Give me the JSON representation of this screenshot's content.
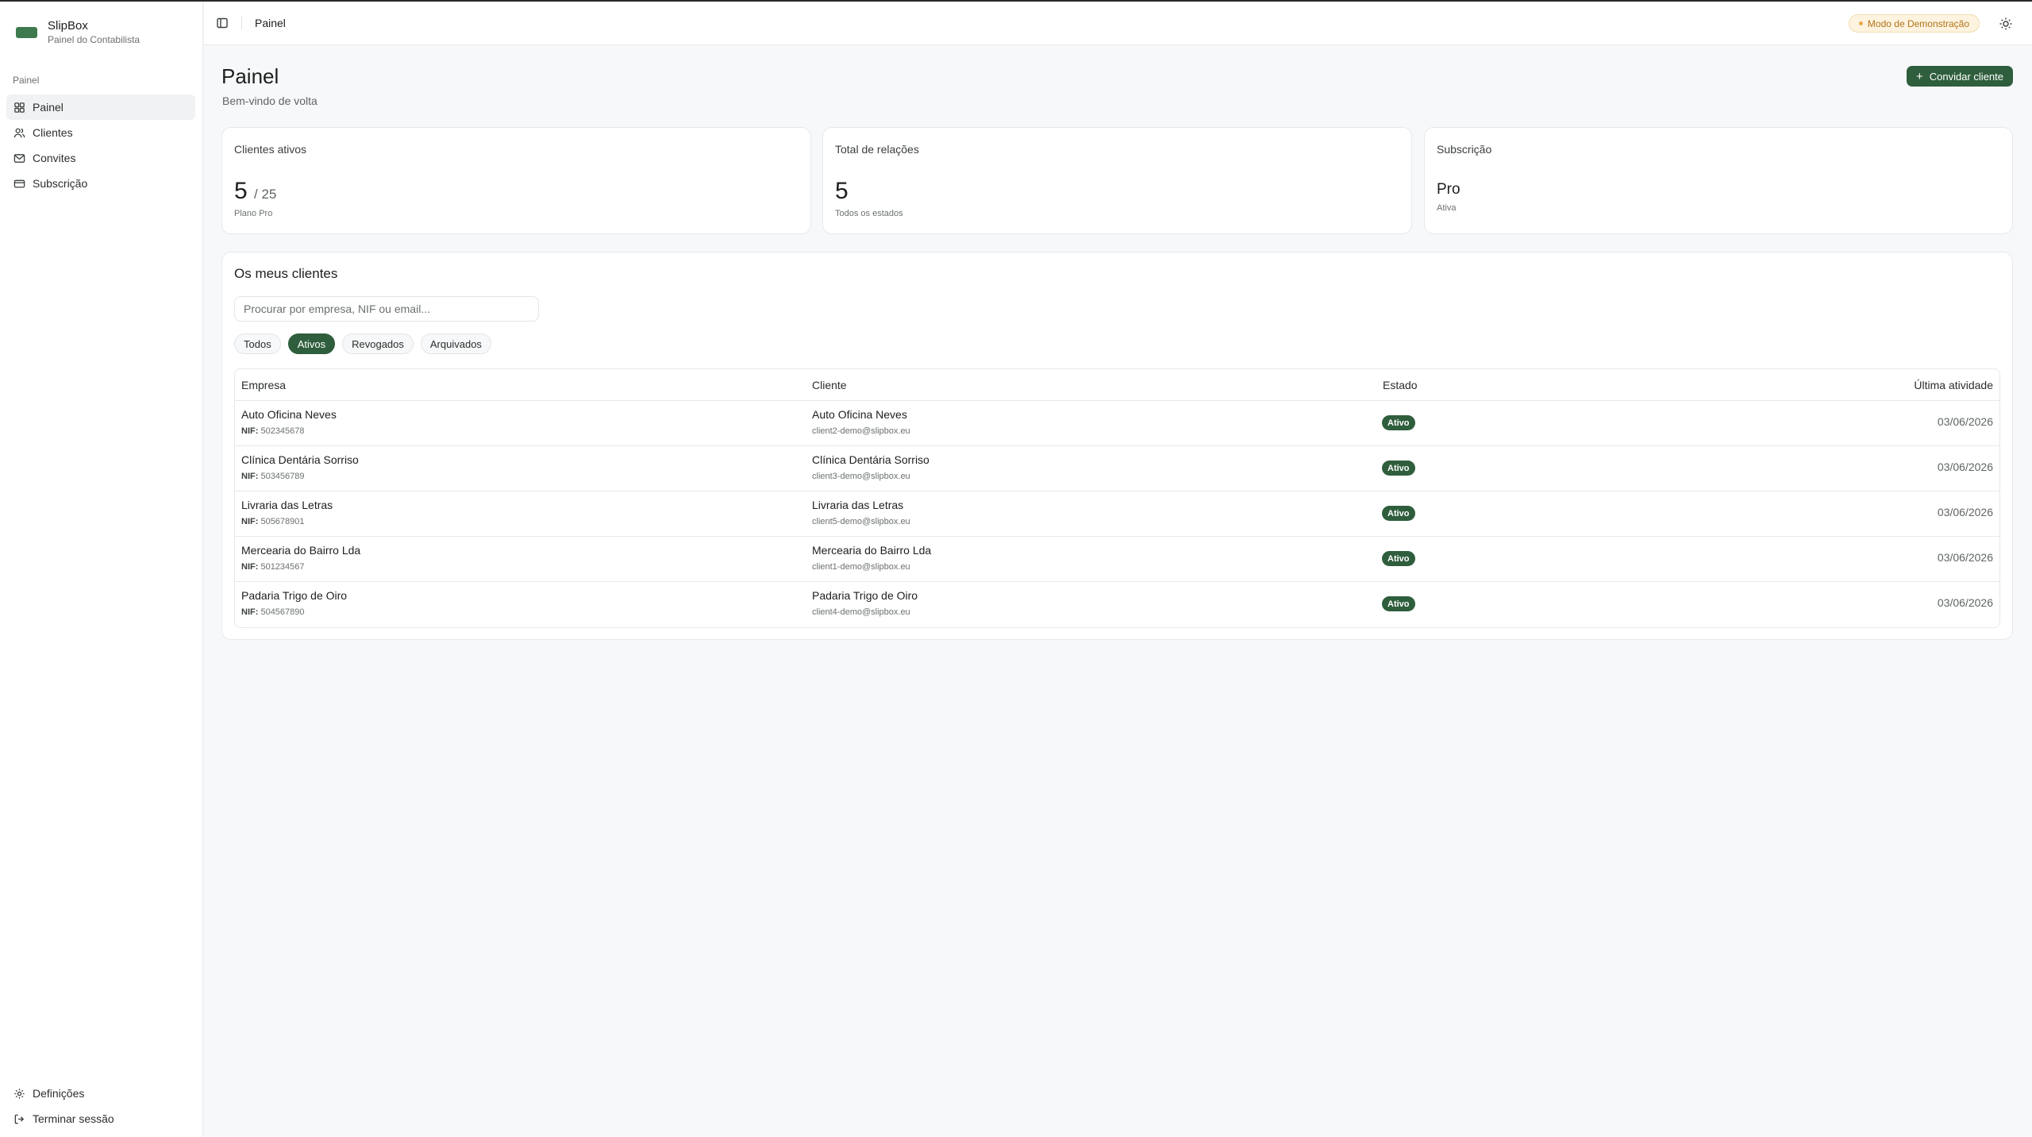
{
  "brand": {
    "name": "SlipBox",
    "subtitle": "Painel do Contabilista"
  },
  "sidebar": {
    "group_label": "Painel",
    "items": [
      {
        "label": "Painel",
        "icon": "grid-icon",
        "active": true
      },
      {
        "label": "Clientes",
        "icon": "users-icon",
        "active": false
      },
      {
        "label": "Convites",
        "icon": "mail-icon",
        "active": false
      },
      {
        "label": "Subscrição",
        "icon": "credit-card-icon",
        "active": false
      }
    ],
    "bottom": [
      {
        "label": "Definições",
        "icon": "gear-icon"
      },
      {
        "label": "Terminar sessão",
        "icon": "logout-icon"
      }
    ]
  },
  "topbar": {
    "title": "Painel",
    "demo_badge": "Modo de Demonstração"
  },
  "page": {
    "title": "Painel",
    "subtitle": "Bem-vindo de volta",
    "invite_button": "Convidar cliente"
  },
  "cards": {
    "active_clients": {
      "label": "Clientes ativos",
      "value": "5",
      "max": "/ 25",
      "foot": "Plano Pro"
    },
    "relations": {
      "label": "Total de relações",
      "value": "5",
      "foot": "Todos os estados"
    },
    "subscription": {
      "label": "Subscrição",
      "value": "Pro",
      "foot": "Ativa"
    }
  },
  "clients": {
    "title": "Os meus clientes",
    "search_placeholder": "Procurar por empresa, NIF ou email...",
    "filters": [
      "Todos",
      "Ativos",
      "Revogados",
      "Arquivados"
    ],
    "active_filter": "Ativos",
    "columns": {
      "company": "Empresa",
      "client": "Cliente",
      "status": "Estado",
      "last_activity": "Última atividade"
    },
    "nif_label": "NIF:",
    "rows": [
      {
        "company": "Auto Oficina Neves",
        "nif": "502345678",
        "client": "Auto Oficina Neves",
        "email": "client2-demo@slipbox.eu",
        "status": "Ativo",
        "date": "03/06/2026"
      },
      {
        "company": "Clínica Dentária Sorriso",
        "nif": "503456789",
        "client": "Clínica Dentária Sorriso",
        "email": "client3-demo@slipbox.eu",
        "status": "Ativo",
        "date": "03/06/2026"
      },
      {
        "company": "Livraria das Letras",
        "nif": "505678901",
        "client": "Livraria das Letras",
        "email": "client5-demo@slipbox.eu",
        "status": "Ativo",
        "date": "03/06/2026"
      },
      {
        "company": "Mercearia do Bairro Lda",
        "nif": "501234567",
        "client": "Mercearia do Bairro Lda",
        "email": "client1-demo@slipbox.eu",
        "status": "Ativo",
        "date": "03/06/2026"
      },
      {
        "company": "Padaria Trigo de Oiro",
        "nif": "504567890",
        "client": "Padaria Trigo de Oiro",
        "email": "client4-demo@slipbox.eu",
        "status": "Ativo",
        "date": "03/06/2026"
      }
    ]
  },
  "colors": {
    "accent": "#2f5e3d",
    "brand": "#3e7a4e",
    "demo_badge_bg": "#fdf3df",
    "demo_badge_text": "#b0741a"
  }
}
